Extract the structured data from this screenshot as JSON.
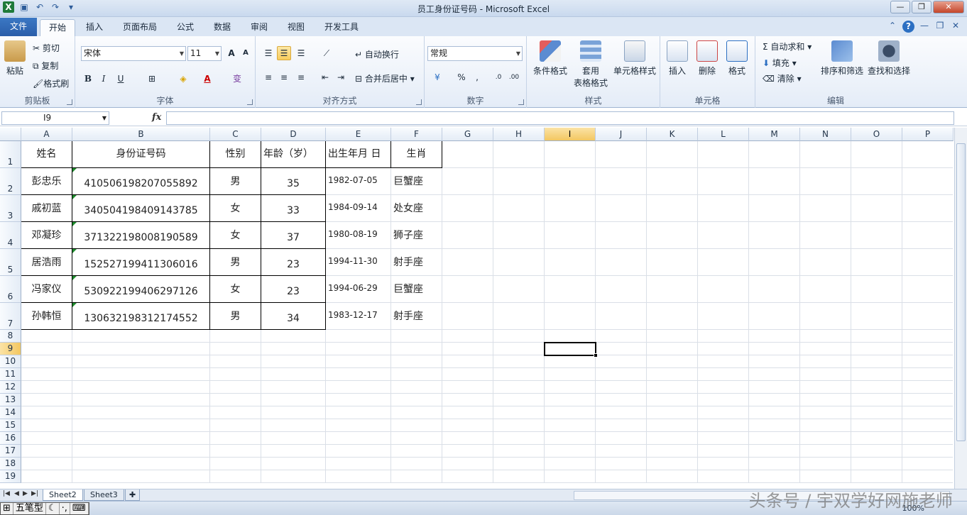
{
  "window": {
    "title": "员工身份证号码 - Microsoft Excel"
  },
  "tabs": [
    "文件",
    "开始",
    "插入",
    "页面布局",
    "公式",
    "数据",
    "审阅",
    "视图",
    "开发工具"
  ],
  "ribbon": {
    "clipboard": {
      "label": "剪贴板",
      "paste": "粘贴",
      "cut": "剪切",
      "copy": "复制",
      "format_painter": "格式刷"
    },
    "font": {
      "label": "字体",
      "name": "宋体",
      "size": "11"
    },
    "alignment": {
      "label": "对齐方式",
      "wrap": "自动换行",
      "merge": "合并后居中"
    },
    "number": {
      "label": "数字",
      "format": "常规"
    },
    "styles": {
      "label": "样式",
      "conditional": "条件格式",
      "table_line1": "套用",
      "table_line2": "表格格式",
      "cell_styles": "单元格样式"
    },
    "cells": {
      "label": "单元格",
      "insert": "插入",
      "delete": "删除",
      "format": "格式"
    },
    "editing": {
      "label": "编辑",
      "autosum": "自动求和",
      "fill": "填充",
      "clear": "清除",
      "sort": "排序和筛选",
      "find": "查找和选择"
    }
  },
  "name_box": "I9",
  "columns": [
    "A",
    "B",
    "C",
    "D",
    "E",
    "F",
    "G",
    "H",
    "I",
    "J",
    "K",
    "L",
    "M",
    "N",
    "O",
    "P"
  ],
  "rows": [
    "1",
    "2",
    "3",
    "4",
    "5",
    "6",
    "7",
    "8",
    "9",
    "10",
    "11",
    "12",
    "13",
    "14",
    "15",
    "16",
    "17",
    "18",
    "19"
  ],
  "table": {
    "headers": [
      "姓名",
      "身份证号码",
      "性别",
      "年龄（岁）",
      "出生年月 日",
      "生肖"
    ],
    "rows": [
      [
        "彭忠乐",
        "410506198207055892",
        "男",
        "35",
        "1982-07-05",
        "巨蟹座"
      ],
      [
        "戚初蓝",
        "340504198409143785",
        "女",
        "33",
        "1984-09-14",
        "处女座"
      ],
      [
        "邓凝珍",
        "371322198008190589",
        "女",
        "37",
        "1980-08-19",
        "狮子座"
      ],
      [
        "居浩雨",
        "152527199411306016",
        "男",
        "23",
        "1994-11-30",
        "射手座"
      ],
      [
        "冯家仪",
        "530922199406297126",
        "女",
        "23",
        "1994-06-29",
        "巨蟹座"
      ],
      [
        "孙韩恒",
        "130632198312174552",
        "男",
        "34",
        "1983-12-17",
        "射手座"
      ]
    ]
  },
  "sheets": [
    "Sheet2",
    "Sheet3"
  ],
  "status": {
    "ime": [
      "五笔型"
    ],
    "zoom": "100%"
  },
  "watermark": "头条号 / 宇双学好网施老师"
}
